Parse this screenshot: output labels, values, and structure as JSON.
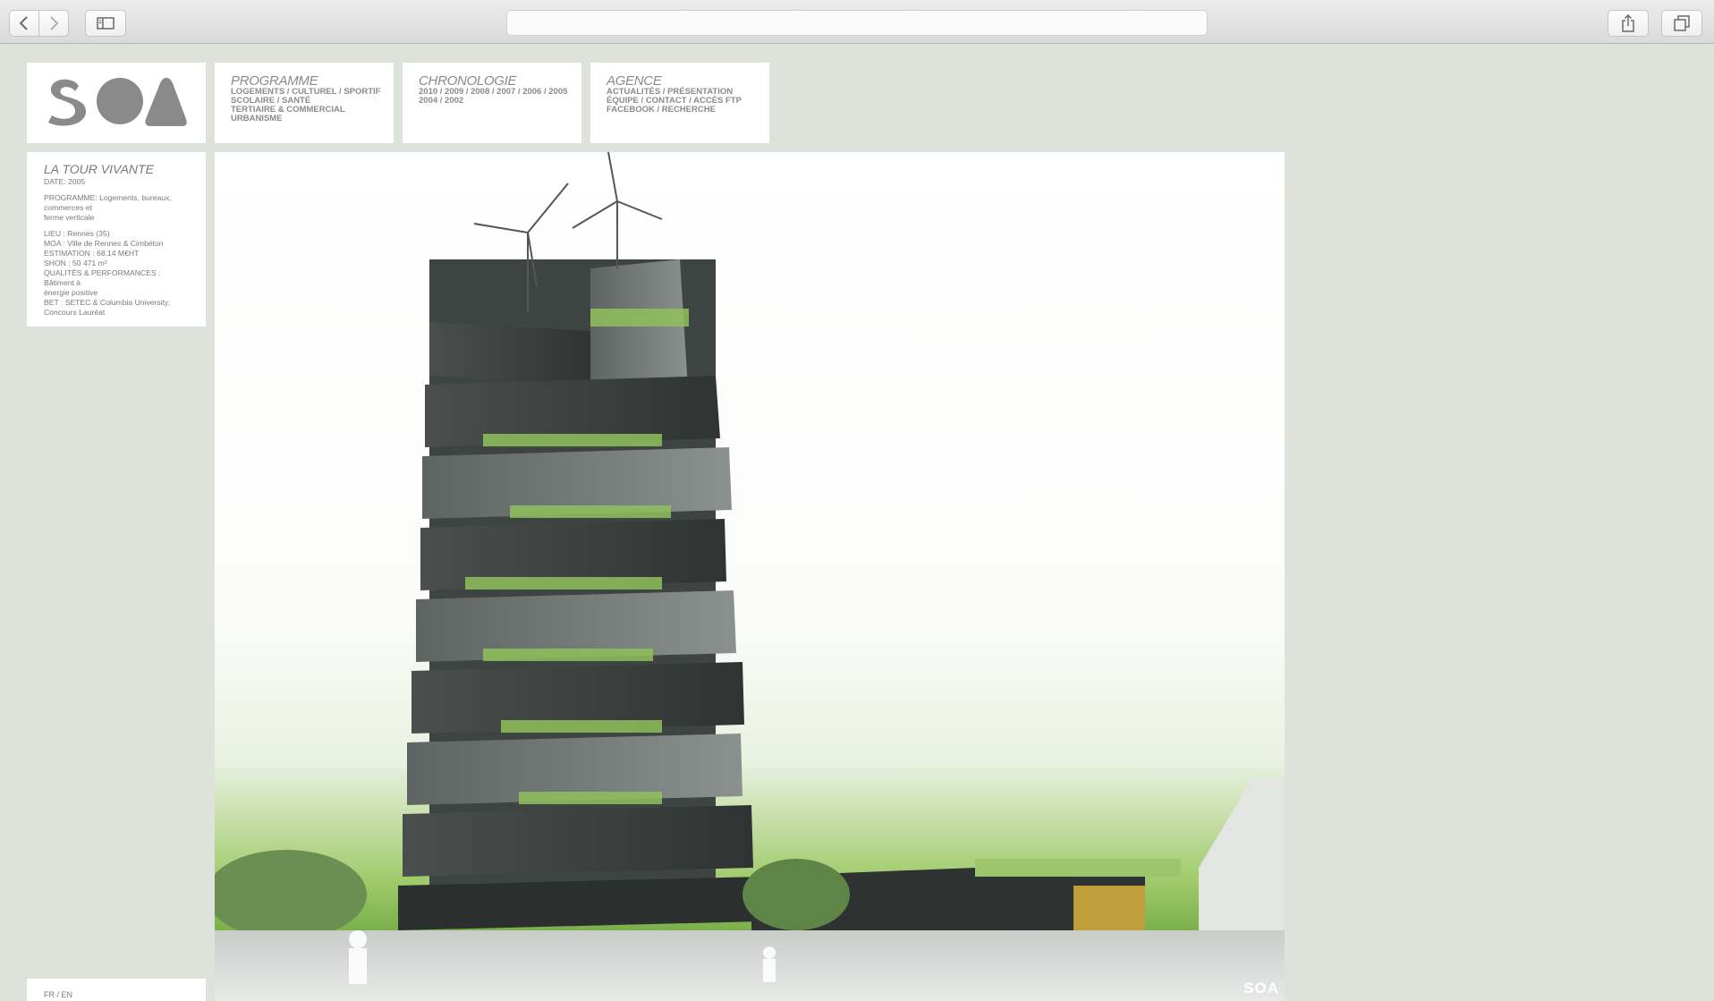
{
  "browser": {
    "address_value": "",
    "icons": [
      "chevron-left-icon",
      "chevron-right-icon",
      "sidebar-icon",
      "share-icon",
      "tabs-icon"
    ]
  },
  "site": {
    "logo_text": "SOA",
    "colors": {
      "background": "#dde2db",
      "panel": "#ffffff",
      "text": "#7c7c7c",
      "logo": "#8a8a8a"
    }
  },
  "nav": {
    "programme": {
      "title": "PROGRAMME",
      "lines": [
        "LOGEMENTS / CULTUREL / SPORTIF",
        "SCOLAIRE / SANTÉ",
        "TERTIAIRE & COMMERCIAL",
        "URBANISME"
      ]
    },
    "chronologie": {
      "title": "CHRONOLOGIE",
      "lines": [
        "2010 / 2009 / 2008 / 2007 / 2006 / 2005",
        "2004 / 2002"
      ]
    },
    "agence": {
      "title": "AGENCE",
      "lines": [
        "ACTUALITÉS / PRÉSENTATION",
        "ÉQUIPE / CONTACT / ACCÈS FTP",
        "FACEBOOK / RECHERCHE"
      ]
    }
  },
  "project": {
    "title": "LA TOUR VIVANTE",
    "date": "DATE: 2005",
    "programme_lines": [
      "PROGRAMME: Logements, bureaux,",
      "commerces et",
      "ferme verticale"
    ],
    "details": [
      "LIEU : Rennes (35)",
      "MOA : Ville de Rennes & Cimbéton",
      "ESTIMATION : 68.14 M€HT",
      "SHON : 50 471 m²",
      "QUALITÉS & PERFORMANCES : Bâtiment à",
      "énergie positive",
      "BET : SETEC & Columbia University.",
      "Concours Lauréat"
    ]
  },
  "language": {
    "label": "FR / EN"
  },
  "hero": {
    "watermark": "SOA"
  }
}
